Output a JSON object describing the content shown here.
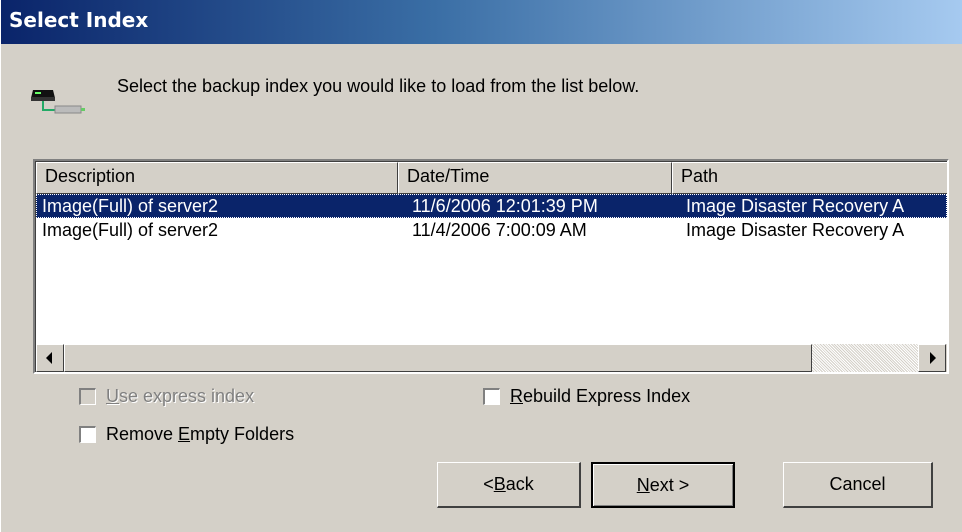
{
  "window": {
    "title": "Select Index"
  },
  "header": {
    "instruction": "Select the backup index you would like to load from the list below.",
    "icon": "backup-drive-icon"
  },
  "list": {
    "columns": [
      "Description",
      "Date/Time",
      "Path"
    ],
    "rows": [
      {
        "description": "Image(Full) of server2",
        "datetime": "11/6/2006 12:01:39 PM",
        "path": "Image Disaster Recovery A",
        "selected": true
      },
      {
        "description": "Image(Full) of server2",
        "datetime": "11/4/2006 7:00:09 AM",
        "path": "Image Disaster Recovery A",
        "selected": false
      }
    ]
  },
  "options": {
    "use_express_index": {
      "pre": "",
      "ul": "U",
      "post": "se express index",
      "checked": false,
      "disabled": true
    },
    "rebuild_express_index": {
      "pre": "",
      "ul": "R",
      "post": "ebuild Express Index",
      "checked": false,
      "disabled": false
    },
    "remove_empty_folders": {
      "pre": "Remove ",
      "ul": "E",
      "post": "mpty Folders",
      "checked": false,
      "disabled": false
    }
  },
  "buttons": {
    "back": {
      "pre": "< ",
      "ul": "B",
      "post": "ack"
    },
    "next": {
      "pre": "",
      "ul": "N",
      "post": "ext >"
    },
    "cancel": {
      "label": "Cancel"
    }
  },
  "colors": {
    "selection": "#0a246a",
    "dialog_bg": "#d4d0c8",
    "title_start": "#0a246a",
    "title_end": "#a6caf0"
  }
}
